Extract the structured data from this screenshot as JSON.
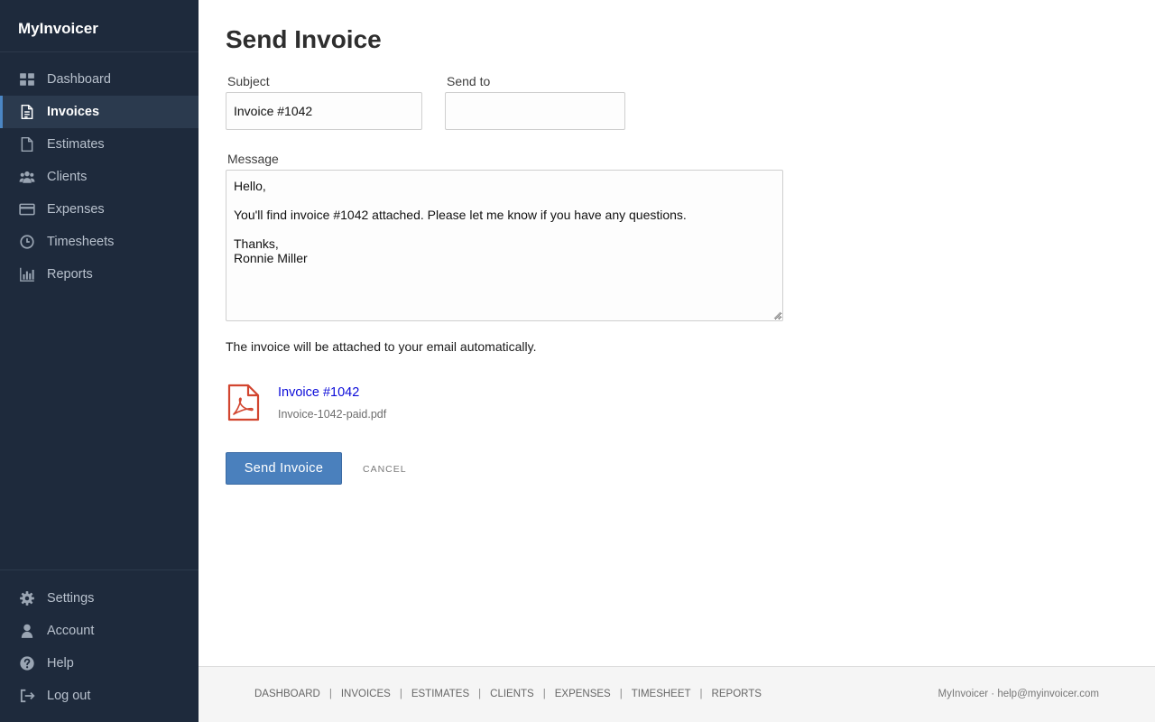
{
  "app": {
    "name": "MyInvoicer"
  },
  "sidebar": {
    "items": [
      {
        "label": "Dashboard",
        "icon": "dashboard-icon"
      },
      {
        "label": "Invoices",
        "icon": "document-icon",
        "active": true
      },
      {
        "label": "Estimates",
        "icon": "file-icon"
      },
      {
        "label": "Clients",
        "icon": "users-icon"
      },
      {
        "label": "Expenses",
        "icon": "credit-card-icon"
      },
      {
        "label": "Timesheets",
        "icon": "clock-icon"
      },
      {
        "label": "Reports",
        "icon": "bar-chart-icon"
      }
    ],
    "bottom_items": [
      {
        "label": "Settings",
        "icon": "gear-icon"
      },
      {
        "label": "Account",
        "icon": "user-icon"
      },
      {
        "label": "Help",
        "icon": "help-icon"
      },
      {
        "label": "Log out",
        "icon": "logout-icon"
      }
    ]
  },
  "main": {
    "title": "Send Invoice",
    "subject": {
      "label": "Subject",
      "value": "Invoice #1042"
    },
    "send_to": {
      "label": "Send to",
      "value": ""
    },
    "message": {
      "label": "Message",
      "value": "Hello,\n\nYou'll find invoice #1042 attached. Please let me know if you have any questions.\n\nThanks,\nRonnie Miller"
    },
    "hint": "The invoice will be attached to your email automatically.",
    "attachment": {
      "title": "Invoice #1042",
      "filename": "Invoice-1042-paid.pdf",
      "icon": "pdf-icon"
    },
    "send_label": "Send Invoice",
    "cancel_label": "CANCEL"
  },
  "footer": {
    "links": [
      "DASHBOARD",
      "INVOICES",
      "ESTIMATES",
      "CLIENTS",
      "EXPENSES",
      "TIMESHEET",
      "REPORTS"
    ],
    "separator": "|",
    "right_text": "MyInvoicer · help@myinvoicer.com"
  },
  "colors": {
    "sidebar_bg": "#1e2a3c",
    "active_item_bg": "#2b3a4e",
    "accent": "#4a80bd",
    "link": "#0b0bd9",
    "pdf_red": "#d2452f"
  }
}
